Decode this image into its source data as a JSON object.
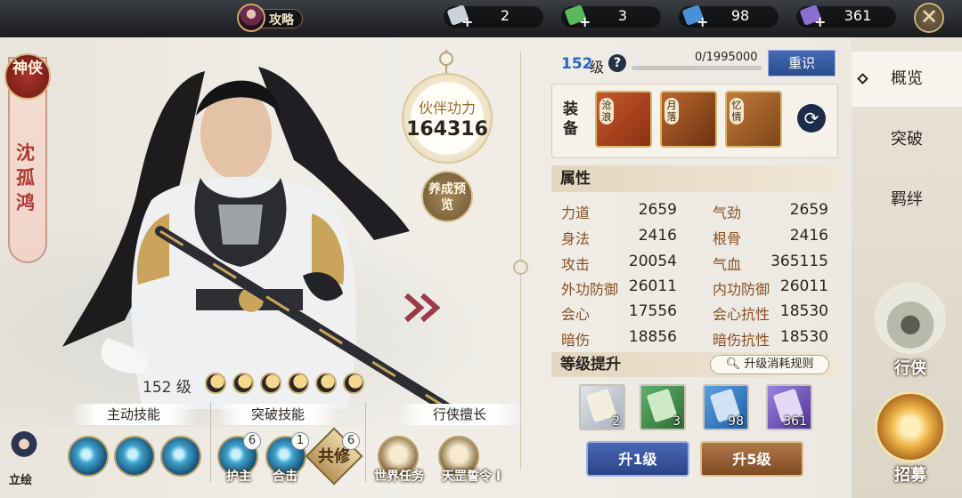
{
  "topbar": {
    "guide_label": "攻略",
    "resources": [
      {
        "icon": "gray-exp-scroll-icon",
        "color": "#c9d1db",
        "value": "2"
      },
      {
        "icon": "green-exp-scroll-icon",
        "color": "#5cb85c",
        "value": "3"
      },
      {
        "icon": "blue-exp-scroll-icon",
        "color": "#4a90d9",
        "value": "98"
      },
      {
        "icon": "purple-exp-scroll-icon",
        "color": "#8a6fd1",
        "value": "361"
      }
    ],
    "plus": "+",
    "close": "✕"
  },
  "character": {
    "rank": "神侠",
    "name": "沈孤鸿",
    "power_title": "伙伴功力",
    "power_value": "164316",
    "preview_label": "养成预览",
    "level_text": "152 级",
    "stars": 6
  },
  "skills": {
    "active_header": "主动技能",
    "break_header": "突破技能",
    "walker_header": "行侠擅长",
    "active": [
      {
        "icon": "sword-slash-skill-icon"
      },
      {
        "icon": "dash-strike-skill-icon"
      },
      {
        "icon": "whirl-skill-icon"
      }
    ],
    "breakthrough": [
      {
        "icon": "guard-skill-icon",
        "label": "护主",
        "badge": "6"
      },
      {
        "icon": "combo-strike-skill-icon",
        "label": "合击",
        "badge": "1"
      },
      {
        "icon": "co-cultivate-icon",
        "label": "共修",
        "badge": "6"
      }
    ],
    "walker": [
      {
        "icon": "world-task-icon",
        "label": "世界任务"
      },
      {
        "icon": "tianyang-order-icon",
        "label": "天罡誓令 I"
      }
    ],
    "portrait_label": "立绘"
  },
  "info": {
    "level_num": "152",
    "level_unit": "级",
    "help": "?",
    "exp_text": "0/1995000",
    "exp_progress": 0.0,
    "reset_label": "重识",
    "equip_label": "装备",
    "equipment": [
      {
        "icon": "sword-equip-icon",
        "tag": "沧浪",
        "color": "#c65a2a"
      },
      {
        "icon": "armor-equip-icon",
        "tag": "月落",
        "color": "#b9662c"
      },
      {
        "icon": "accessory-equip-icon",
        "tag": "忆情",
        "color": "#c57a3a"
      }
    ],
    "attr_header": "属性",
    "attributes": [
      {
        "name": "力道",
        "value": "2659"
      },
      {
        "name": "气劲",
        "value": "2659"
      },
      {
        "name": "身法",
        "value": "2416"
      },
      {
        "name": "根骨",
        "value": "2416"
      },
      {
        "name": "攻击",
        "value": "20054"
      },
      {
        "name": "气血",
        "value": "365115"
      },
      {
        "name": "外功防御",
        "value": "26011"
      },
      {
        "name": "内功防御",
        "value": "26011"
      },
      {
        "name": "会心",
        "value": "17556"
      },
      {
        "name": "会心抗性",
        "value": "18530"
      },
      {
        "name": "暗伤",
        "value": "18856"
      },
      {
        "name": "暗伤抗性",
        "value": "18530"
      }
    ],
    "levelup_header": "等级提升",
    "rules_label": "升级消耗规则",
    "items": [
      {
        "icon": "gray-exp-book-icon",
        "count": "2",
        "color": "#c8ccd4"
      },
      {
        "icon": "green-exp-book-icon",
        "count": "3",
        "color": "#3e8d48"
      },
      {
        "icon": "blue-exp-book-icon",
        "count": "98",
        "color": "#3479c4"
      },
      {
        "icon": "purple-exp-book-icon",
        "count": "361",
        "color": "#6b4fb8"
      }
    ],
    "up1_label": "升1级",
    "up5_label": "升5级"
  },
  "nav": {
    "tabs": [
      "概览",
      "突破",
      "羁绊"
    ],
    "active_tab": "概览",
    "xingxia_label": "行侠",
    "zhaomu_label": "招募"
  }
}
